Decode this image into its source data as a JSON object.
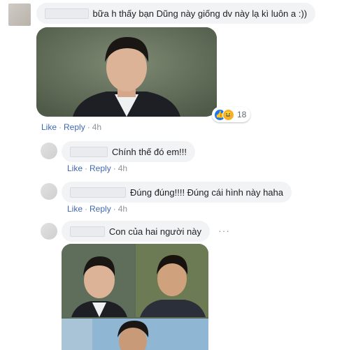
{
  "comments": [
    {
      "text": "bữa h thấy bạn Dũng này giống dv này lạ kì luôn a :))",
      "actions": {
        "like": "Like",
        "reply": "Reply",
        "time": "4h"
      },
      "reactions": {
        "count": "18",
        "icons": [
          "like-icon",
          "haha-icon"
        ]
      }
    }
  ],
  "replies": [
    {
      "text": "Chính thế đó em!!!",
      "actions": {
        "like": "Like",
        "reply": "Reply",
        "time": "4h"
      }
    },
    {
      "text": "Đúng đúng!!!! Đúng cái hình này haha",
      "actions": {
        "like": "Like",
        "reply": "Reply",
        "time": "4h"
      }
    },
    {
      "text": "Con của hai người này",
      "more": "···"
    }
  ],
  "colors": {
    "link": "#4267b2",
    "bubble": "#f2f3f5",
    "meta": "#90949c"
  }
}
